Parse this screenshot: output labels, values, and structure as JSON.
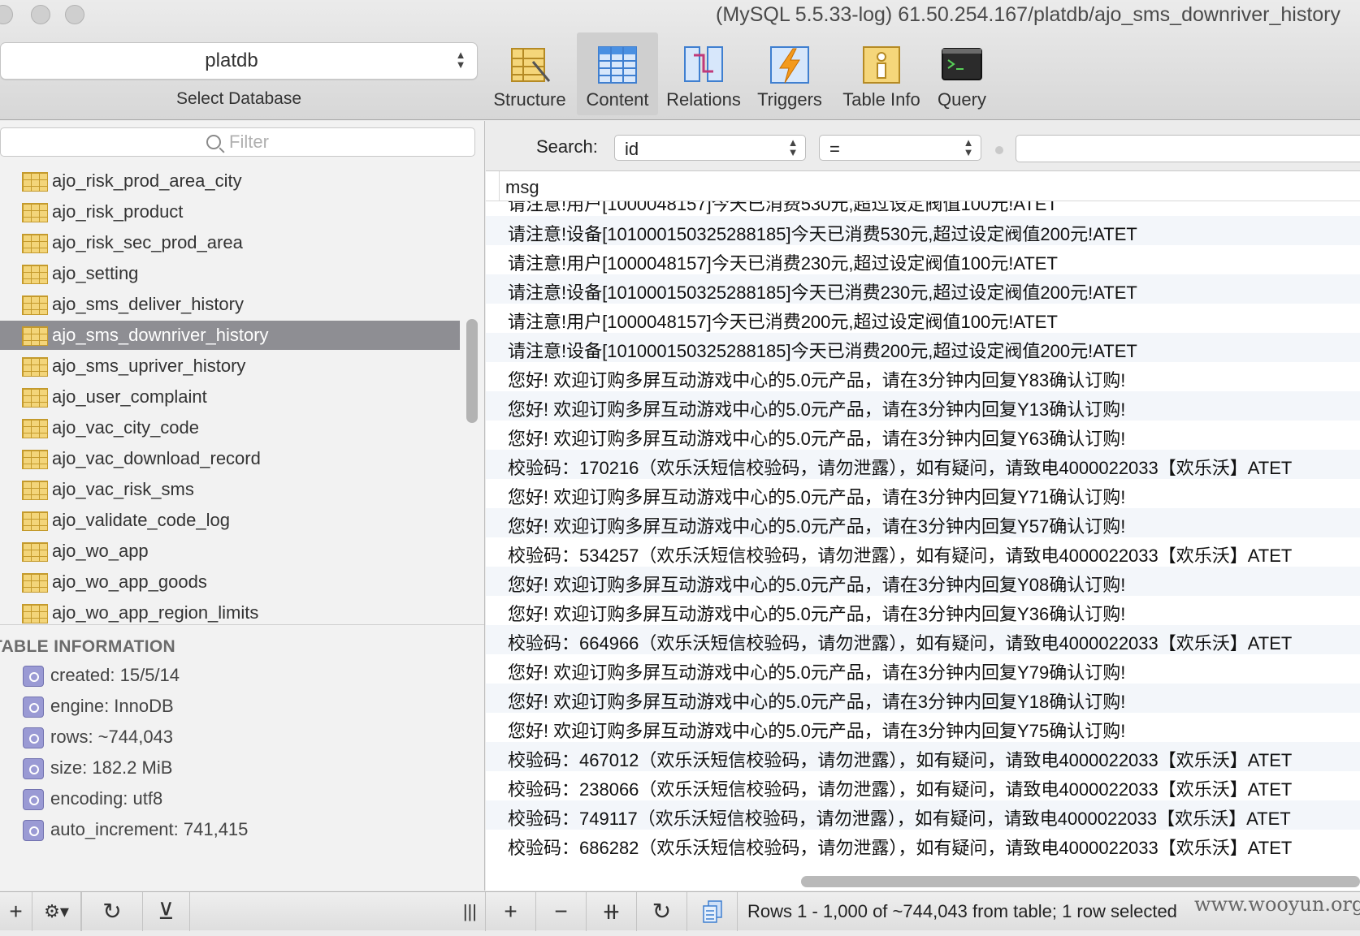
{
  "window": {
    "title": "(MySQL 5.5.33-log) 61.50.254.167/platdb/ajo_sms_downriver_history"
  },
  "database_selector": {
    "value": "platdb",
    "caption": "Select Database"
  },
  "toolbar": {
    "buttons": [
      {
        "label": "Structure",
        "icon": "structure-icon"
      },
      {
        "label": "Content",
        "icon": "content-icon",
        "active": true
      },
      {
        "label": "Relations",
        "icon": "relations-icon"
      },
      {
        "label": "Triggers",
        "icon": "triggers-icon"
      },
      {
        "label": "Table Info",
        "icon": "table-info-icon"
      },
      {
        "label": "Query",
        "icon": "query-icon"
      }
    ]
  },
  "sidebar": {
    "filter_placeholder": "Filter",
    "tables": [
      "ajo_risk_prod_area_city",
      "ajo_risk_product",
      "ajo_risk_sec_prod_area",
      "ajo_setting",
      "ajo_sms_deliver_history",
      "ajo_sms_downriver_history",
      "ajo_sms_upriver_history",
      "ajo_user_complaint",
      "ajo_vac_city_code",
      "ajo_vac_download_record",
      "ajo_vac_risk_sms",
      "ajo_validate_code_log",
      "ajo_wo_app",
      "ajo_wo_app_goods",
      "ajo_wo_app_region_limits"
    ],
    "selected_table": "ajo_sms_downriver_history",
    "info_heading": "TABLE INFORMATION",
    "info": [
      "created: 15/5/14",
      "engine: InnoDB",
      "rows: ~744,043",
      "size: 182.2 MiB",
      "encoding: utf8",
      "auto_increment: 741,415"
    ]
  },
  "search": {
    "label": "Search:",
    "field": "id",
    "operator": "=",
    "value": ""
  },
  "grid": {
    "column": "msg",
    "rows": [
      "请注意!设备[10100015032528818​5]今天已消费530元,超过设定阀值200元!ATET",
      "请注意!用户[1000048157]今天已消费230元,超过设定阀值100元!ATET",
      "请注意!设备[10100015032528818​5]今天已消费230元,超过设定阀值200元!ATET",
      "请注意!用户[1000048157]今天已消费200元,超过设定阀值100元!ATET",
      "请注意!设备[10100015032528818​5]今天已消费200元,超过设定阀值200元!ATET",
      "您好! 欢迎订购多屏互动游戏中心的5.0元产品，请在3分钟内回复Y83确认订购!",
      "您好! 欢迎订购多屏互动游戏中心的5.0元产品，请在3分钟内回复Y13确认订购!",
      "您好! 欢迎订购多屏互动游戏中心的5.0元产品，请在3分钟内回复Y63确认订购!",
      "校验码：170216（欢乐沃短信校验码，请勿泄露），如有疑问，请致电4000022033【欢乐沃】ATET",
      "您好! 欢迎订购多屏互动游戏中心的5.0元产品，请在3分钟内回复Y71确认订购!",
      "您好! 欢迎订购多屏互动游戏中心的5.0元产品，请在3分钟内回复Y57确认订购!",
      "校验码：534257（欢乐沃短信校验码，请勿泄露），如有疑问，请致电4000022033【欢乐沃】ATET",
      "您好! 欢迎订购多屏互动游戏中心的5.0元产品，请在3分钟内回复Y08确认订购!",
      "您好! 欢迎订购多屏互动游戏中心的5.0元产品，请在3分钟内回复Y36确认订购!",
      "校验码：664966（欢乐沃短信校验码，请勿泄露），如有疑问，请致电4000022033【欢乐沃】ATET",
      "您好! 欢迎订购多屏互动游戏中心的5.0元产品，请在3分钟内回复Y79确认订购!",
      "您好! 欢迎订购多屏互动游戏中心的5.0元产品，请在3分钟内回复Y18确认订购!",
      "您好! 欢迎订购多屏互动游戏中心的5.0元产品，请在3分钟内回复Y75确认订购!",
      "校验码：467012（欢乐沃短信校验码，请勿泄露），如有疑问，请致电4000022033【欢乐沃】ATET",
      "校验码：238066（欢乐沃短信校验码，请勿泄露），如有疑问，请致电4000022033【欢乐沃】ATET",
      "校验码：749117（欢乐沃短信校验码，请勿泄露），如有疑问，请致电4000022033【欢乐沃】ATET",
      "校验码：686282（欢乐沃短信校验码，请勿泄露），如有疑问，请致电4000022033【欢乐沃】ATET"
    ]
  },
  "bottom_bar": {
    "left_buttons": [
      "+",
      "⚙▾",
      "↻",
      "⊻"
    ],
    "right_buttons": [
      "+",
      "−",
      "⧺",
      "↻"
    ],
    "status": "Rows 1 - 1,000 of ~744,043 from table; 1 row selected"
  },
  "watermark": "www.wooyun.org"
}
